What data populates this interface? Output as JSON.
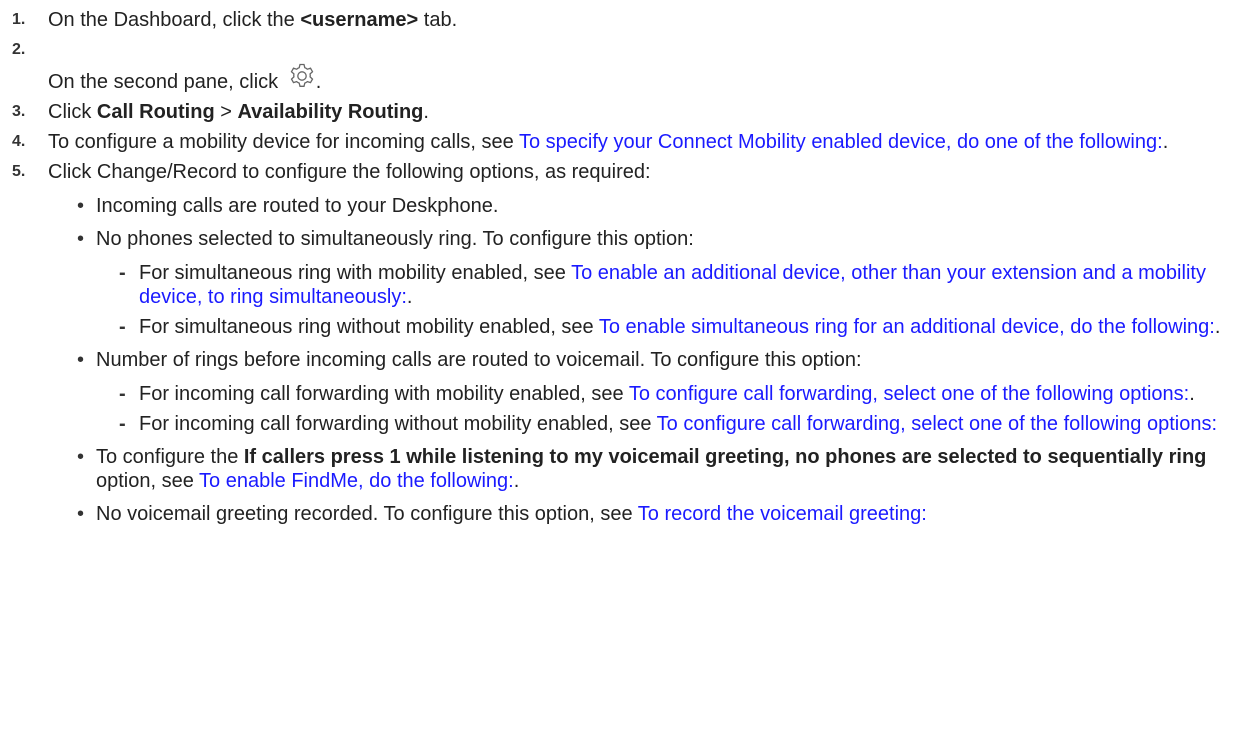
{
  "steps": [
    {
      "num": "1.",
      "pre": "On the Dashboard, click the ",
      "bold": "<username>",
      "post": " tab."
    },
    {
      "num": "2.",
      "pre": "On the second pane, click ",
      "post": ".",
      "icon": "gear-icon"
    },
    {
      "num": "3.",
      "pre": "Click ",
      "bold1": "Call Routing",
      "mid": " > ",
      "bold2": "Availability Routing",
      "post": "."
    },
    {
      "num": "4.",
      "pre": "To configure a mobility device for incoming calls, see ",
      "link": "To specify your Connect Mobility enabled device, do one of the following:",
      "post": "."
    },
    {
      "num": "5.",
      "text": "Click Change/Record to configure the following options, as required:"
    }
  ],
  "bullets": [
    {
      "text": "Incoming calls are routed to your Deskphone."
    },
    {
      "text": "No phones selected to simultaneously ring. To configure this option:",
      "subs": [
        {
          "pre": "For simultaneous ring with mobility enabled, see ",
          "link": "To enable an additional device, other than your extension and a mobility device, to ring simultaneously:",
          "post": "."
        },
        {
          "pre": "For simultaneous ring without mobility enabled, see ",
          "link": "To enable simultaneous ring for an additional device, do the following:",
          "post": "."
        }
      ]
    },
    {
      "text": "Number of rings before incoming calls are routed to voicemail. To configure this option:",
      "subs": [
        {
          "pre": "For incoming call forwarding with mobility enabled, see ",
          "link": "To configure call forwarding, select one of the following options:",
          "post": "."
        },
        {
          "pre": "For incoming call forwarding without mobility enabled, see ",
          "link": "To configure call forwarding, select one of the following options:",
          "post": ""
        }
      ]
    },
    {
      "pre": "To configure the ",
      "bold": "If callers press 1 while listening to my voicemail greeting, no phones are selected to sequentially ring",
      "mid": " option, see ",
      "link": "To enable FindMe, do the following:",
      "post": "."
    },
    {
      "pre": "No voicemail greeting recorded. To configure this option, see ",
      "link": "To record the voicemail greeting:",
      "post": ""
    }
  ],
  "glyphs": {
    "bullet": "•",
    "dash": "-"
  },
  "colors": {
    "link": "#1a1aff",
    "text": "#222222"
  }
}
